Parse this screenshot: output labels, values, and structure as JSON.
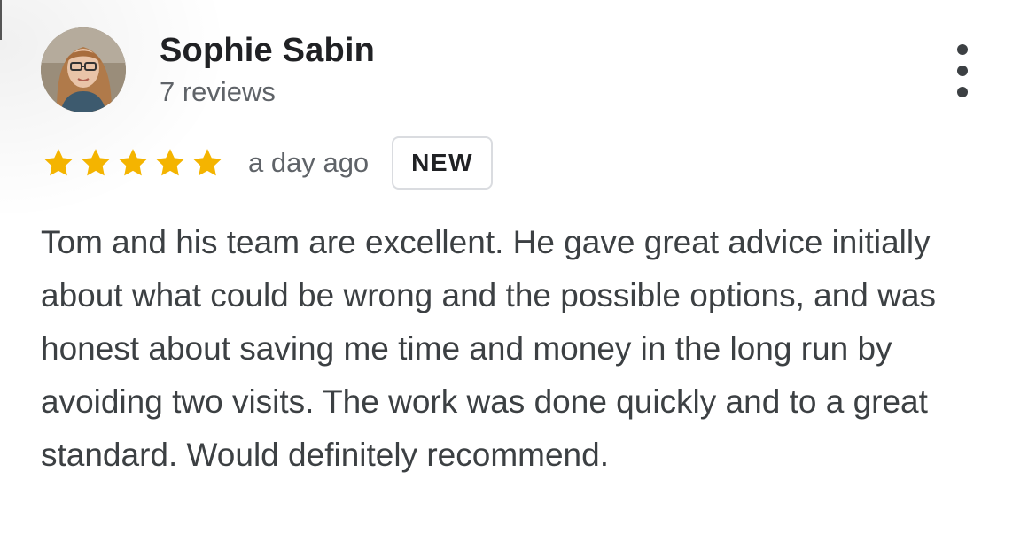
{
  "review": {
    "author_name": "Sophie Sabin",
    "author_reviews": "7 reviews",
    "rating": 5,
    "rating_max": 5,
    "time_ago": "a day ago",
    "badge": "NEW",
    "text": "Tom and his team are excellent. He gave great advice initially about what could be wrong and the possible options, and was honest about saving me time and money in the long run by avoiding two visits. The work was done quickly and to a great standard. Would definitely recommend."
  },
  "icons": {
    "avatar": "profile-photo",
    "star": "star-icon",
    "menu": "more-vert-icon"
  },
  "colors": {
    "star": "#f4b400",
    "name": "#202124",
    "secondary_text": "#5f6368",
    "body_text": "#3c4043",
    "badge_border": "#dadce0"
  }
}
